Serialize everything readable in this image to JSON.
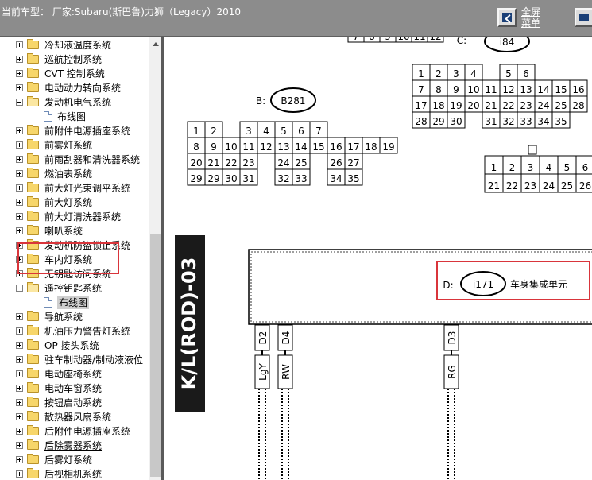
{
  "header": {
    "title": "当前车型： 厂家:Subaru(斯巴鲁)力狮（Legacy）2010",
    "fullscreen_link": "全屏菜单"
  },
  "sidebar": {
    "items": [
      {
        "label": "冷却液温度系统",
        "level": 0,
        "expander": "plus",
        "icon": "folder-icon"
      },
      {
        "label": "巡航控制系统",
        "level": 0,
        "expander": "plus",
        "icon": "folder-icon"
      },
      {
        "label": "CVT 控制系统",
        "level": 0,
        "expander": "plus",
        "icon": "folder-icon"
      },
      {
        "label": "电动动力转向系统",
        "level": 0,
        "expander": "plus",
        "icon": "folder-icon"
      },
      {
        "label": "发动机电气系统",
        "level": 0,
        "expander": "minus",
        "icon": "folder-open-icon"
      },
      {
        "label": "布线图",
        "level": 1,
        "expander": "none",
        "icon": "document-icon"
      },
      {
        "label": "前附件电源插座系统",
        "level": 0,
        "expander": "plus",
        "icon": "folder-icon"
      },
      {
        "label": "前雾灯系统",
        "level": 0,
        "expander": "plus",
        "icon": "folder-icon"
      },
      {
        "label": "前雨刮器和清洗器系统",
        "level": 0,
        "expander": "plus",
        "icon": "folder-icon"
      },
      {
        "label": "燃油表系统",
        "level": 0,
        "expander": "plus",
        "icon": "folder-icon"
      },
      {
        "label": "前大灯光束调平系统",
        "level": 0,
        "expander": "plus",
        "icon": "folder-icon"
      },
      {
        "label": "前大灯系统",
        "level": 0,
        "expander": "plus",
        "icon": "folder-icon"
      },
      {
        "label": "前大灯清洗器系统",
        "level": 0,
        "expander": "plus",
        "icon": "folder-icon"
      },
      {
        "label": "喇叭系统",
        "level": 0,
        "expander": "plus",
        "icon": "folder-icon"
      },
      {
        "label": "发动机防盗锁止系统",
        "level": 0,
        "expander": "plus",
        "icon": "folder-icon"
      },
      {
        "label": "车内灯系统",
        "level": 0,
        "expander": "plus",
        "icon": "folder-icon"
      },
      {
        "label": "无钥匙访问系统",
        "level": 0,
        "expander": "plus",
        "icon": "folder-icon"
      },
      {
        "label": "遥控钥匙系统",
        "level": 0,
        "expander": "minus",
        "icon": "folder-open-icon"
      },
      {
        "label": "布线图",
        "level": 1,
        "expander": "none",
        "icon": "document-icon",
        "selected": true
      },
      {
        "label": "导航系统",
        "level": 0,
        "expander": "plus",
        "icon": "folder-icon"
      },
      {
        "label": "机油压力警告灯系统",
        "level": 0,
        "expander": "plus",
        "icon": "folder-icon"
      },
      {
        "label": "OP 接头系统",
        "level": 0,
        "expander": "plus",
        "icon": "folder-icon"
      },
      {
        "label": "驻车制动器/制动液液位",
        "level": 0,
        "expander": "plus",
        "icon": "folder-icon"
      },
      {
        "label": "电动座椅系统",
        "level": 0,
        "expander": "plus",
        "icon": "folder-icon"
      },
      {
        "label": "电动车窗系统",
        "level": 0,
        "expander": "plus",
        "icon": "folder-icon"
      },
      {
        "label": "按钮启动系统",
        "level": 0,
        "expander": "plus",
        "icon": "folder-icon"
      },
      {
        "label": "散热器风扇系统",
        "level": 0,
        "expander": "plus",
        "icon": "folder-icon"
      },
      {
        "label": "后附件电源插座系统",
        "level": 0,
        "expander": "plus",
        "icon": "folder-icon"
      },
      {
        "label": "后除雾器系统",
        "level": 0,
        "expander": "plus",
        "icon": "folder-icon",
        "underlined": true
      },
      {
        "label": "后雾灯系统",
        "level": 0,
        "expander": "plus",
        "icon": "folder-icon"
      },
      {
        "label": "后视相机系统",
        "level": 0,
        "expander": "plus",
        "icon": "folder-icon"
      }
    ]
  },
  "diagram": {
    "connector_c": {
      "prefix": "C:",
      "id": "i84"
    },
    "connector_b": {
      "prefix": "B:",
      "id": "B281"
    },
    "connector_d": {
      "prefix": "D:",
      "id": "i171",
      "name": "车身集成单元"
    },
    "top_partial_pins": [
      "7",
      "8",
      "9",
      "10",
      "11",
      "12"
    ],
    "b281_rows": [
      [
        "1",
        "2",
        "",
        "3",
        "4",
        "5",
        "6",
        "7"
      ],
      [
        "8",
        "9",
        "10",
        "11",
        "12",
        "13",
        "14",
        "15",
        "16",
        "17",
        "18",
        "19"
      ],
      [
        "20",
        "21",
        "22",
        "23",
        "",
        "24",
        "25",
        "",
        "26",
        "27"
      ],
      [
        "29",
        "29",
        "30",
        "31",
        "",
        "32",
        "33",
        "",
        "34",
        "35"
      ]
    ],
    "i84_rows": [
      [
        "1",
        "2",
        "3",
        "4",
        "",
        "5",
        "6"
      ],
      [
        "7",
        "8",
        "9",
        "10",
        "11",
        "12",
        "13",
        "14",
        "15",
        "16"
      ],
      [
        "17",
        "18",
        "19",
        "20",
        "21",
        "22",
        "23",
        "24",
        "25",
        "28"
      ],
      [
        "28",
        "29",
        "30",
        "",
        "31",
        "32",
        "33",
        "34",
        "35"
      ]
    ],
    "right_connector_rows": [
      [
        "1",
        "2",
        "3",
        "4",
        "5",
        "6"
      ],
      [
        "21",
        "22",
        "23",
        "24",
        "25",
        "26"
      ]
    ],
    "harness_label": "K/L(ROD)-03",
    "pins": [
      {
        "pin": "D2",
        "wire": "LgY"
      },
      {
        "pin": "D4",
        "wire": "RW"
      },
      {
        "pin": "D3",
        "wire": "RG"
      }
    ],
    "highlight_color": "#d9353b"
  }
}
